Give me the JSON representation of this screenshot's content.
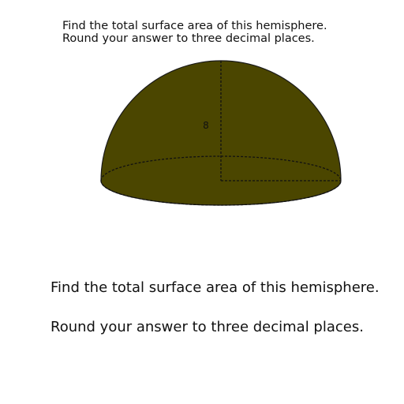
{
  "header": {
    "line1": "Find the total surface area of this hemisphere.",
    "line2": "Round your answer to three decimal places."
  },
  "diagram": {
    "radius_label": "8",
    "fill_color": "#4b4600",
    "stroke_color": "#1a1a1a"
  },
  "body": {
    "line1": "Find the total surface area of this hemisphere.",
    "line2": "Round your answer to three decimal places."
  }
}
